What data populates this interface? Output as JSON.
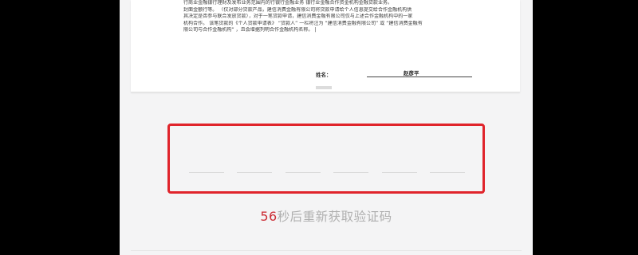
{
  "document": {
    "lines": [
      "行商业金融银行理财及发布业务范围内的行银行金融业务 银行业金融合作资金机构金融贷款业务。",
      "封面金额行等。 （仅对部分贷款产品，建信消费金融有限公司将贷款申请给个人信息提交给合作金融机构供",
      "其决定是否参与联合发放贷款），对于一笔贷款申请，建信消费金融有限公司仅与上述合作金融机构中的一家",
      "机构合作。 该笔贷款的《个人贷款申请表》 “贷款人” 一栏将注为 “建信消费金融有限公司” 或 “建信消费金融有",
      "限公司与合作金融机构” ，且会增据列明合作金融机构名称。 |"
    ],
    "signature_label": "姓名：",
    "signature_name": "赵彦平"
  },
  "verification": {
    "code_slots": [
      "",
      "",
      "",
      "",
      "",
      ""
    ],
    "countdown_seconds": "56",
    "countdown_text": "秒后重新获取验证码"
  },
  "colors": {
    "highlight_border": "#e0242b",
    "countdown_number": "#cc2e36",
    "countdown_text": "#b0b0b0"
  }
}
